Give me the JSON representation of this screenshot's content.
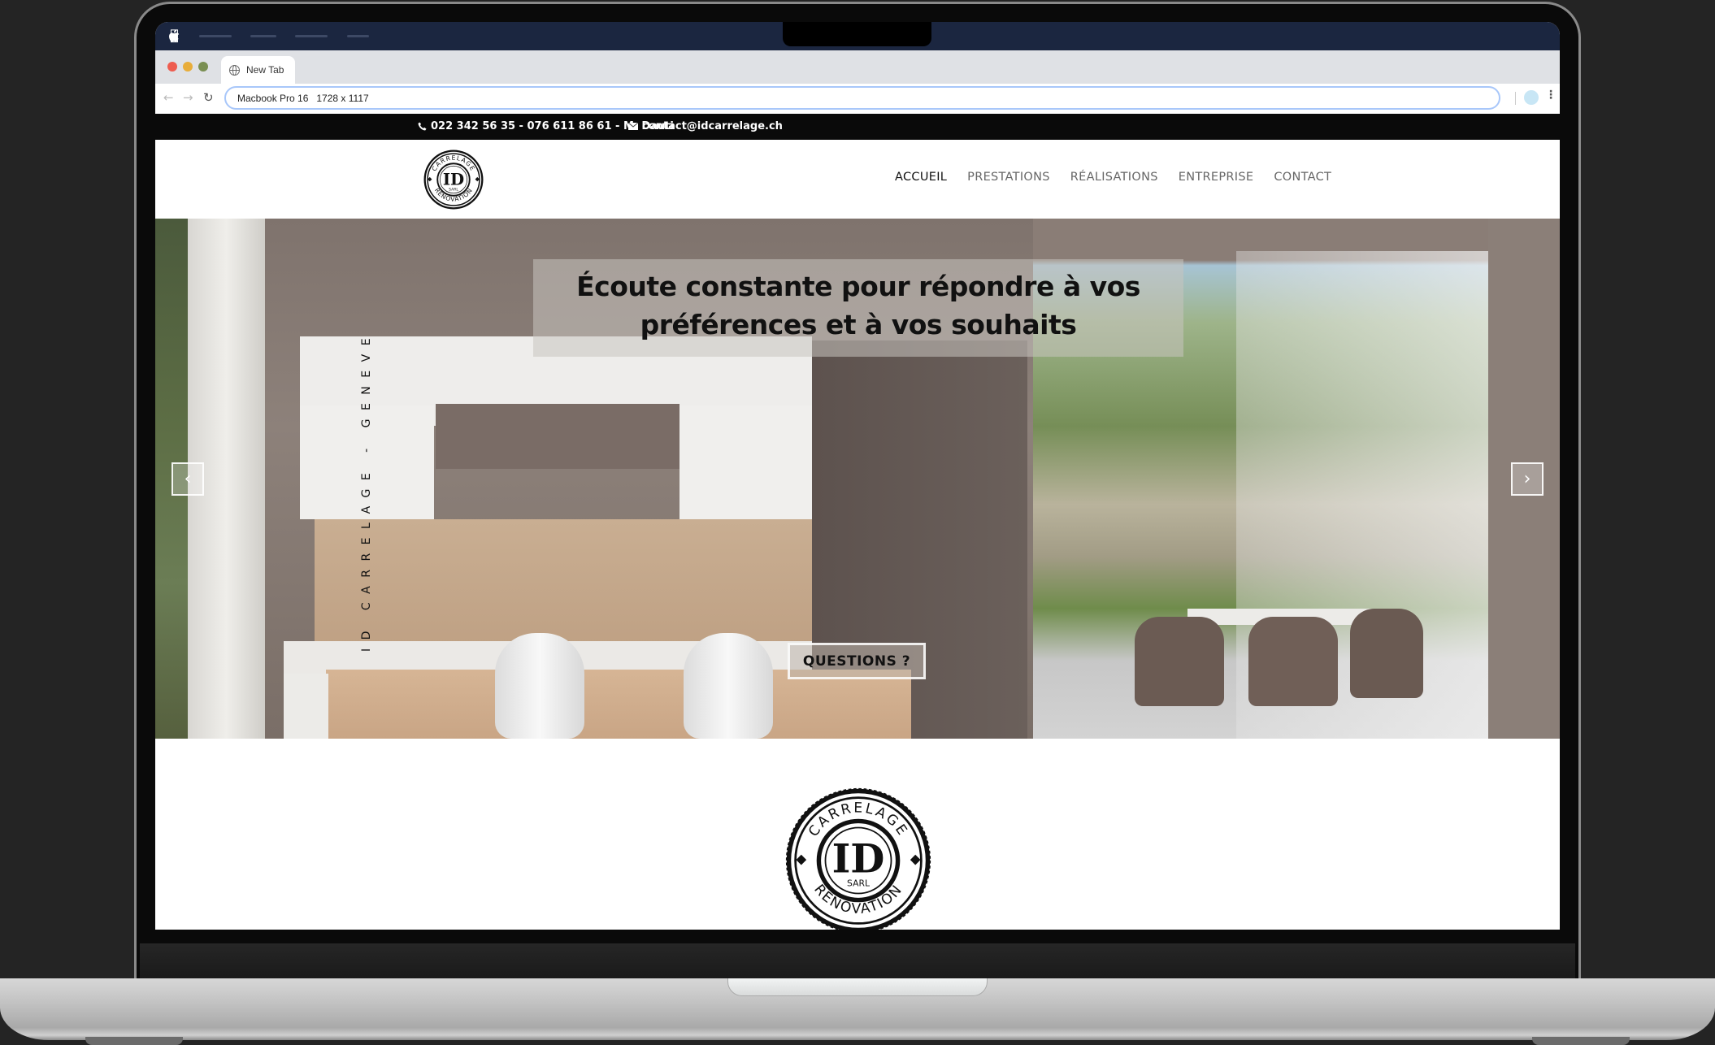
{
  "os": {
    "menu_items_count": 4
  },
  "browser": {
    "tab_title": "New Tab",
    "url_text": "Macbook Pro 16   1728 x 1117",
    "traffic_lights": {
      "close": "#ee5c4f",
      "minimize": "#e8ad3a",
      "maximize": "#7a8f52"
    }
  },
  "site": {
    "topbar": {
      "phone": "022 342 56 35 - 076 611 86 61 - M. Dauti",
      "email": "contact@idcarrelage.ch"
    },
    "logo": {
      "top": "CARRELAGE",
      "center": "ID",
      "sub": "SARL",
      "bottom": "RENOVATION"
    },
    "nav": [
      {
        "label": "ACCUEIL",
        "active": true
      },
      {
        "label": "PRESTATIONS",
        "active": false
      },
      {
        "label": "RÉALISATIONS",
        "active": false
      },
      {
        "label": "ENTREPRISE",
        "active": false
      },
      {
        "label": "CONTACT",
        "active": false
      }
    ],
    "hero": {
      "title_line1": "Écoute constante pour répondre à vos",
      "title_line2": "préférences et à vos souhaits",
      "vertical_text": "ID CARRELAGE - GENEVE",
      "prev_arrow": "‹",
      "next_arrow": "›",
      "cta_label": "QUESTIONS ?"
    }
  }
}
